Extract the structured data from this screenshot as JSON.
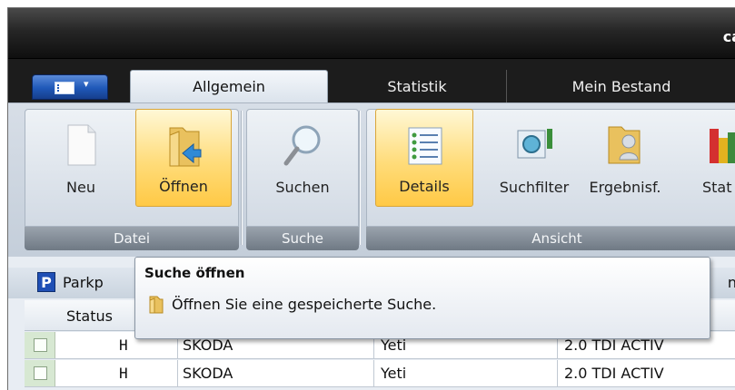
{
  "window": {
    "title_fragment": "ca"
  },
  "tabs": [
    {
      "label": "Allgemein",
      "active": true
    },
    {
      "label": "Statistik",
      "active": false
    },
    {
      "label": "Mein Bestand",
      "active": false
    }
  ],
  "ribbon": {
    "groups": [
      {
        "label": "Datei",
        "buttons": [
          {
            "label": "Neu",
            "icon": "new-document-icon"
          },
          {
            "label": "Öffnen",
            "icon": "open-folder-icon"
          }
        ]
      },
      {
        "label": "Suche",
        "buttons": [
          {
            "label": "Suchen",
            "icon": "magnifier-icon"
          }
        ]
      },
      {
        "label": "Ansicht",
        "buttons": [
          {
            "label": "Details",
            "icon": "details-list-icon"
          },
          {
            "label": "Suchfilter",
            "icon": "search-filter-icon"
          },
          {
            "label": "Ergebnisf.",
            "icon": "results-folder-icon"
          },
          {
            "label": "Stat",
            "icon": "statistics-icon"
          }
        ]
      }
    ]
  },
  "parkplatz": {
    "badge": "P",
    "label_fragment": "Parkp",
    "tail_fragment": "n"
  },
  "table": {
    "header": {
      "status": "Status"
    },
    "rows": [
      {
        "status": "H",
        "brand": "SKODA",
        "model": "Yeti",
        "variant": "2.0 TDI ACTIV"
      },
      {
        "status": "H",
        "brand": "SKODA",
        "model": "Yeti",
        "variant": "2.0 TDI ACTIV"
      }
    ]
  },
  "tooltip": {
    "title": "Suche öffnen",
    "text": "Öffnen Sie eine gespeicherte Suche."
  },
  "colors": {
    "highlight": "#ffc945",
    "app_button": "#1f58b8",
    "badge": "#1f4fb5"
  }
}
